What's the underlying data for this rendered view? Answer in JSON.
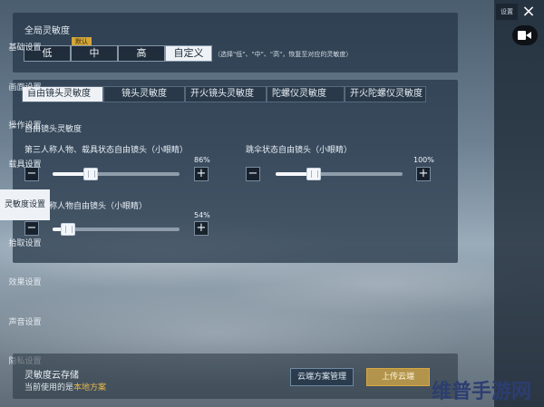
{
  "global": {
    "title": "全局灵敏度",
    "default_badge": "默认",
    "options": [
      "低",
      "中",
      "高",
      "自定义"
    ],
    "selected": "自定义",
    "hint": "（选择\"低\"、\"中\"、\"高\"，恢复至对应的灵敏度）"
  },
  "tabs": [
    {
      "label": "自由镜头灵敏度",
      "active": true
    },
    {
      "label": "镜头灵敏度",
      "active": false
    },
    {
      "label": "开火镜头灵敏度",
      "active": false
    },
    {
      "label": "陀螺仪灵敏度",
      "active": false
    },
    {
      "label": "开火陀螺仪灵敏度",
      "active": false
    }
  ],
  "section": {
    "title": "自由镜头灵敏度"
  },
  "sliders": [
    {
      "label": "第三人称人物、载具状态自由镜头（小眼睛）",
      "percent_text": "86%",
      "value": 0.3
    },
    {
      "label": "跳伞状态自由镜头（小眼睛）",
      "percent_text": "100%",
      "value": 0.3
    },
    {
      "label": "第一人称人物自由镜头（小眼睛）",
      "percent_text": "54%",
      "value": 0.12
    }
  ],
  "controls": {
    "minus": "−",
    "plus": "+"
  },
  "sidebar": {
    "top_label": "设置",
    "close_icon": "×",
    "items": [
      {
        "label": "基础设置",
        "active": false
      },
      {
        "label": "画面设置",
        "active": false
      },
      {
        "label": "操作设置",
        "active": false
      },
      {
        "label": "载具设置",
        "active": false
      },
      {
        "label": "灵敏度设置",
        "active": true
      },
      {
        "label": "拾取设置",
        "active": false
      },
      {
        "label": "效果设置",
        "active": false
      },
      {
        "label": "声音设置",
        "active": false
      },
      {
        "label": "隐私设置",
        "active": false
      }
    ]
  },
  "cloud": {
    "title": "灵敏度云存储",
    "current_prefix": "当前使用的是",
    "current_value": "本地方案",
    "manage_button": "云端方案管理",
    "upload_button": "上传云端"
  },
  "watermark": "维普手游网",
  "colors": {
    "accent": "#d4a63a",
    "active_tab": "#eef2f6",
    "highlight": "#e8b64a"
  }
}
